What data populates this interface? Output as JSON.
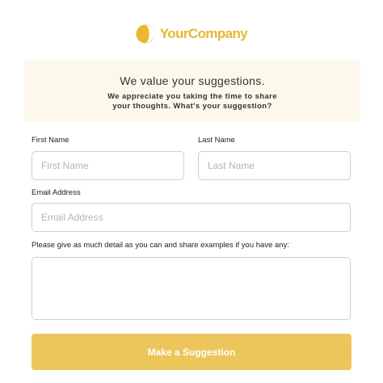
{
  "brand": {
    "name": "YourCompany",
    "color": "#e6b833",
    "icon": "half-moon-logo-icon"
  },
  "intro": {
    "title": "We value your suggestions.",
    "text": "We appreciate you taking the time to share your thoughts. What's your suggestion?",
    "background": "#fcf8eb"
  },
  "form": {
    "first_name": {
      "label": "First Name",
      "placeholder": "First Name",
      "value": ""
    },
    "last_name": {
      "label": "Last Name",
      "placeholder": "Last Name",
      "value": ""
    },
    "email": {
      "label": "Email Address",
      "placeholder": "Email Address",
      "value": ""
    },
    "details": {
      "label": "Please give as much detail as you can and share examples if you have any:",
      "value": ""
    },
    "submit_label": "Make a Suggestion",
    "submit_color": "#ecc55b"
  }
}
